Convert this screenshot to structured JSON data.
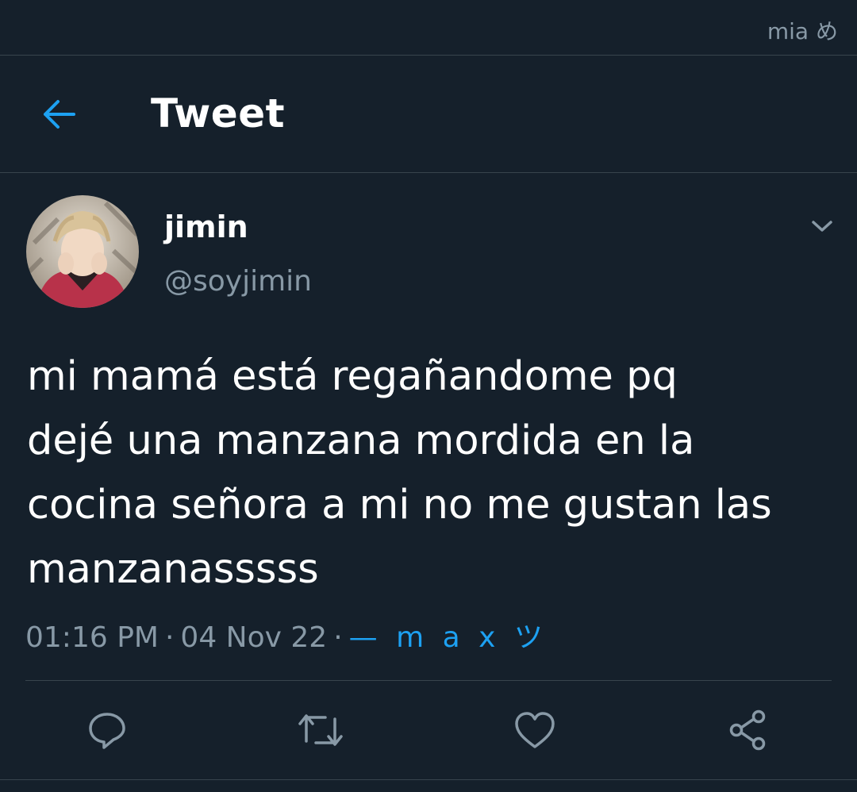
{
  "watermark": "mia め",
  "header": {
    "title": "Tweet",
    "back_icon": "arrow-left-icon"
  },
  "colors": {
    "background": "#15202b",
    "accent": "#1da1f2",
    "secondary_text": "#8899a6",
    "divider": "#38444d"
  },
  "tweet": {
    "author_name": "jimin",
    "author_handle": "@soyjimin",
    "text": "mi mamá está regañandome pq\ndejé una manzana mordida en la\ncocina señora a mi no me gustan las\nmanzanasssss",
    "time": "01:16 PM",
    "date": "04 Nov 22",
    "separator": "·",
    "source": "— m a x ツ"
  },
  "actions": [
    {
      "name": "reply",
      "icon": "reply-icon"
    },
    {
      "name": "retweet",
      "icon": "retweet-icon"
    },
    {
      "name": "like",
      "icon": "heart-icon"
    },
    {
      "name": "share",
      "icon": "share-icon"
    }
  ]
}
